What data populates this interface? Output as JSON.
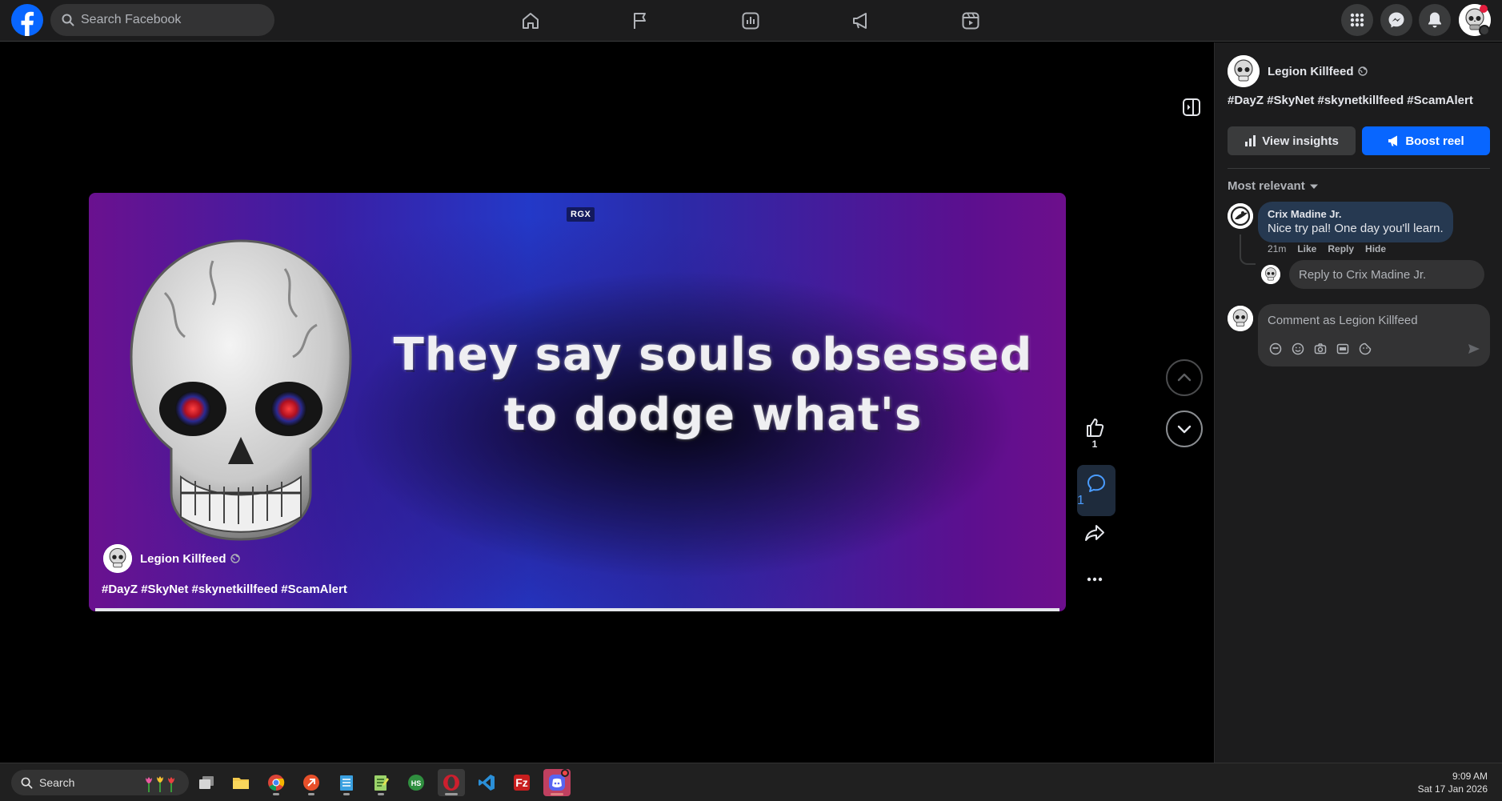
{
  "topbar": {
    "search_placeholder": "Search Facebook",
    "nav_icons": [
      "home-icon",
      "flag-icon",
      "insights-icon",
      "megaphone-icon",
      "reels-icon"
    ],
    "right_icons": [
      "menu-grid-icon",
      "messenger-icon",
      "bell-icon"
    ]
  },
  "reel": {
    "watermark": "RGX",
    "caption_line1": "They say souls obsessed",
    "caption_line2": "to dodge what's",
    "owner_name": "Legion Killfeed",
    "hashtags": "#DayZ #SkyNet #skynetkillfeed #ScamAlert",
    "progress": 1.0,
    "like_count": "1",
    "comment_count": "1"
  },
  "panel": {
    "owner_name": "Legion Killfeed",
    "hashtags": "#DayZ #SkyNet #skynetkillfeed #ScamAlert",
    "insights_label": "View insights",
    "boost_label": "Boost reel",
    "sort_label": "Most relevant",
    "comment": {
      "author": "Crix Madine Jr.",
      "text": "Nice try pal! One day you'll learn.",
      "time": "21m",
      "actions": [
        "Like",
        "Reply",
        "Hide"
      ]
    },
    "reply_placeholder": "Reply to Crix Madine Jr.",
    "comment_placeholder": "Comment as Legion Killfeed"
  },
  "taskbar": {
    "search_label": "Search",
    "time": "9:09 AM",
    "date": "Sat 17 Jan 2026"
  },
  "colors": {
    "accent": "#0866ff",
    "panel_bg": "#1c1c1d",
    "comment_bubble": "#263951"
  }
}
